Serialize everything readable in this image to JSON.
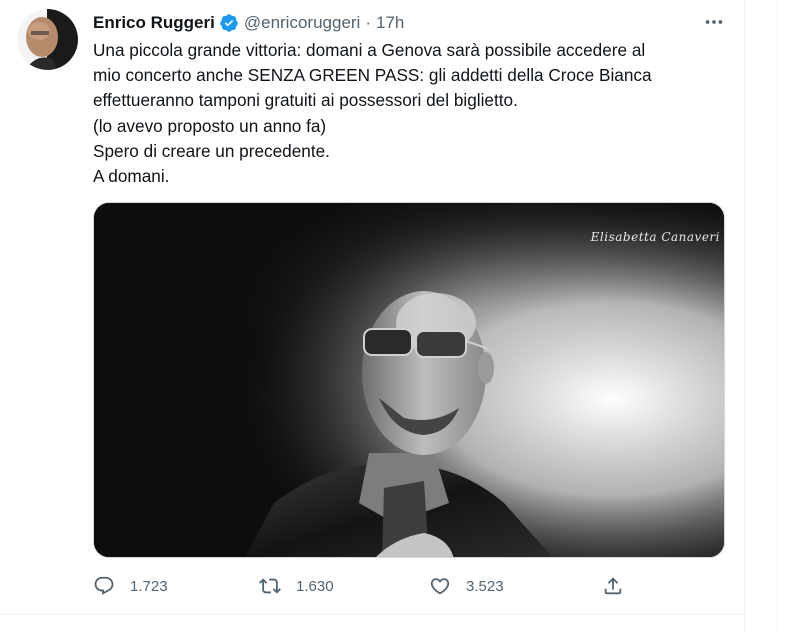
{
  "user": {
    "display_name": "Enrico Ruggeri",
    "handle": "@enricoruggeri",
    "separator": "·",
    "time": "17h",
    "verified_icon": "verified-badge-icon",
    "avatar_alt": "avatar"
  },
  "tweet": {
    "lines": [
      "Una piccola grande vittoria: domani a Genova sarà possibile accedere al",
      "mio concerto anche SENZA GREEN PASS: gli addetti della Croce Bianca",
      "effettueranno tamponi gratuiti ai possessori del biglietto.",
      "(lo avevo proposto un anno fa)",
      "Spero di creare un precedente.",
      "A domani."
    ]
  },
  "media": {
    "watermark": "Elisabetta Canaveri"
  },
  "actions": {
    "reply_count": "1.723",
    "retweet_count": "1.630",
    "like_count": "3.523"
  },
  "colors": {
    "text": "#0f1419",
    "muted": "#536471",
    "verified": "#1d9bf0",
    "border": "#eff3f4"
  }
}
